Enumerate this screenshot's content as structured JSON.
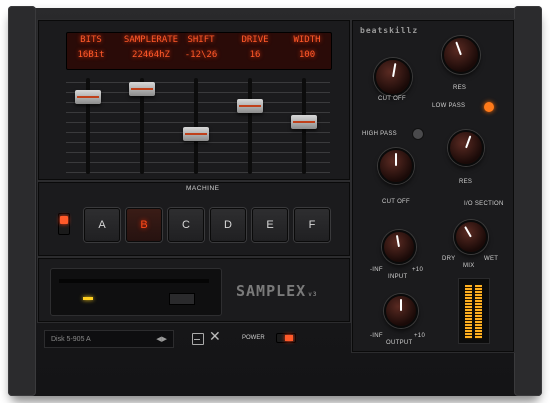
{
  "brand": "beatskillz",
  "product": {
    "name": "SAMPLEX",
    "version": "v3"
  },
  "display": {
    "columns": [
      {
        "header": "BITS",
        "value": "16Bit"
      },
      {
        "header": "SAMPLERATE",
        "value": "22464hZ"
      },
      {
        "header": "SHIFT",
        "value": "-12\\26"
      },
      {
        "header": "DRIVE",
        "value": "16"
      },
      {
        "header": "WIDTH",
        "value": "100"
      }
    ]
  },
  "faders": {
    "levels": [
      0.15,
      0.05,
      0.6,
      0.25,
      0.45
    ]
  },
  "machine": {
    "label": "MACHINE",
    "pads": [
      "A",
      "B",
      "C",
      "D",
      "E",
      "F"
    ],
    "active_pad": "B"
  },
  "filter": {
    "cutoff1_label": "CUT OFF",
    "res1_label": "RES",
    "lowpass_label": "LOW PASS",
    "highpass_label": "HIGH PASS",
    "cutoff2_label": "CUT OFF",
    "res2_label": "RES"
  },
  "io": {
    "section_label": "I/O SECTION",
    "input_label": "INPUT",
    "input_min": "-INF",
    "input_max": "+10",
    "output_label": "OUTPUT",
    "output_min": "-INF",
    "output_max": "+10",
    "mix_label": "MIX",
    "mix_dry": "DRY",
    "mix_wet": "WET"
  },
  "disk": {
    "name": "Disk 5-905 A",
    "arrows": "◀▶"
  },
  "power_label": "POWER",
  "colors": {
    "accent": "#ff5a2a",
    "body": "#1b1b1d"
  }
}
